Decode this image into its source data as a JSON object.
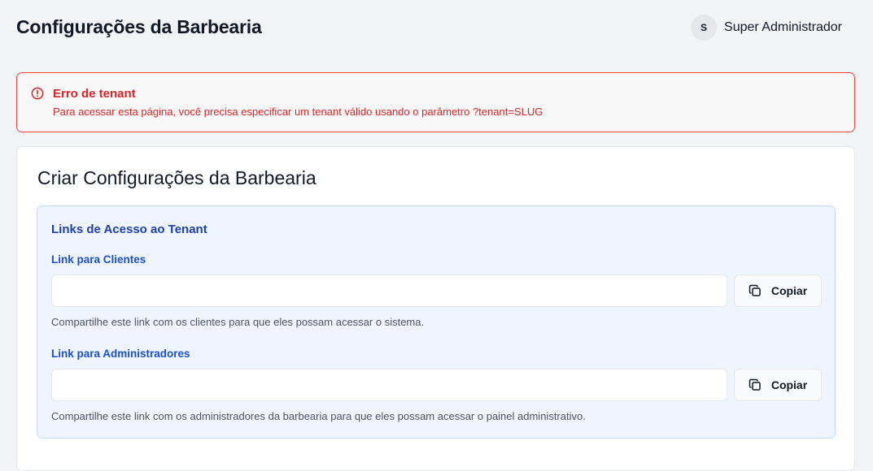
{
  "header": {
    "title": "Configurações da Barbearia",
    "user": {
      "initial": "S",
      "name": "Super Administrador"
    }
  },
  "alert": {
    "icon": "alert-circle-icon",
    "title": "Erro de tenant",
    "message": "Para acessar esta página, você precisa especificar um tenant válido usando o parâmetro ?tenant=SLUG",
    "color": "#dc2626"
  },
  "card": {
    "title": "Criar Configurações da Barbearia",
    "links_panel": {
      "title": "Links de Acesso ao Tenant",
      "client_link": {
        "label": "Link para Clientes",
        "value": "",
        "copy_label": "Copiar",
        "help": "Compartilhe este link com os clientes para que eles possam acessar o sistema."
      },
      "admin_link": {
        "label": "Link para Administradores",
        "value": "",
        "copy_label": "Copiar",
        "help": "Compartilhe este link com os administradores da barbearia para que eles possam acessar o painel administrativo."
      }
    }
  },
  "colors": {
    "accent_blue": "#1d4ed8",
    "panel_bg": "#eef5fe",
    "error": "#ef4444"
  }
}
